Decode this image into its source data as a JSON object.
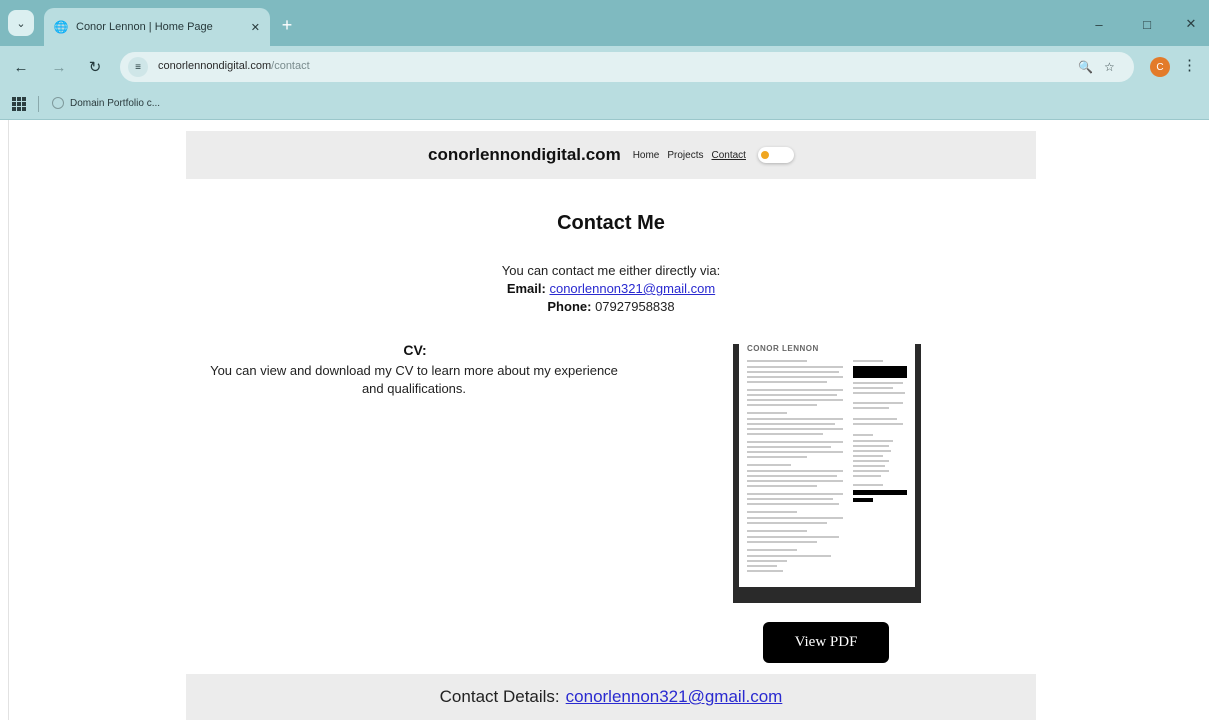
{
  "browser": {
    "tab_title": "Conor Lennon | Home Page",
    "url_host": "conorlennondigital.com",
    "url_path": "/contact",
    "bookmark_label": "Domain Portfolio c...",
    "profile_initial": "C"
  },
  "header": {
    "brand": "conorlennondigital.com",
    "nav": [
      {
        "label": "Home"
      },
      {
        "label": "Projects"
      },
      {
        "label": "Contact"
      }
    ]
  },
  "contact": {
    "title": "Contact Me",
    "intro": "You can contact me either directly via:",
    "email_label": "Email:",
    "email_value": "conorlennon321@gmail.com",
    "phone_label": "Phone:",
    "phone_value": "07927958838"
  },
  "cv": {
    "title": "CV:",
    "description": "You can view and download my CV to learn more about my experience and qualifications.",
    "preview_name": "CONOR LENNON",
    "button_label": "View PDF"
  },
  "footer": {
    "label": "Contact Details:",
    "email": "conorlennon321@gmail.com"
  },
  "colors": {
    "chrome_bg": "#7fbac0",
    "toolbar_bg": "#b9dde0",
    "link": "#2a2ad0",
    "header_bg": "#ececec",
    "toggle_knob": "#f0a620",
    "profile": "#e37b2a"
  }
}
